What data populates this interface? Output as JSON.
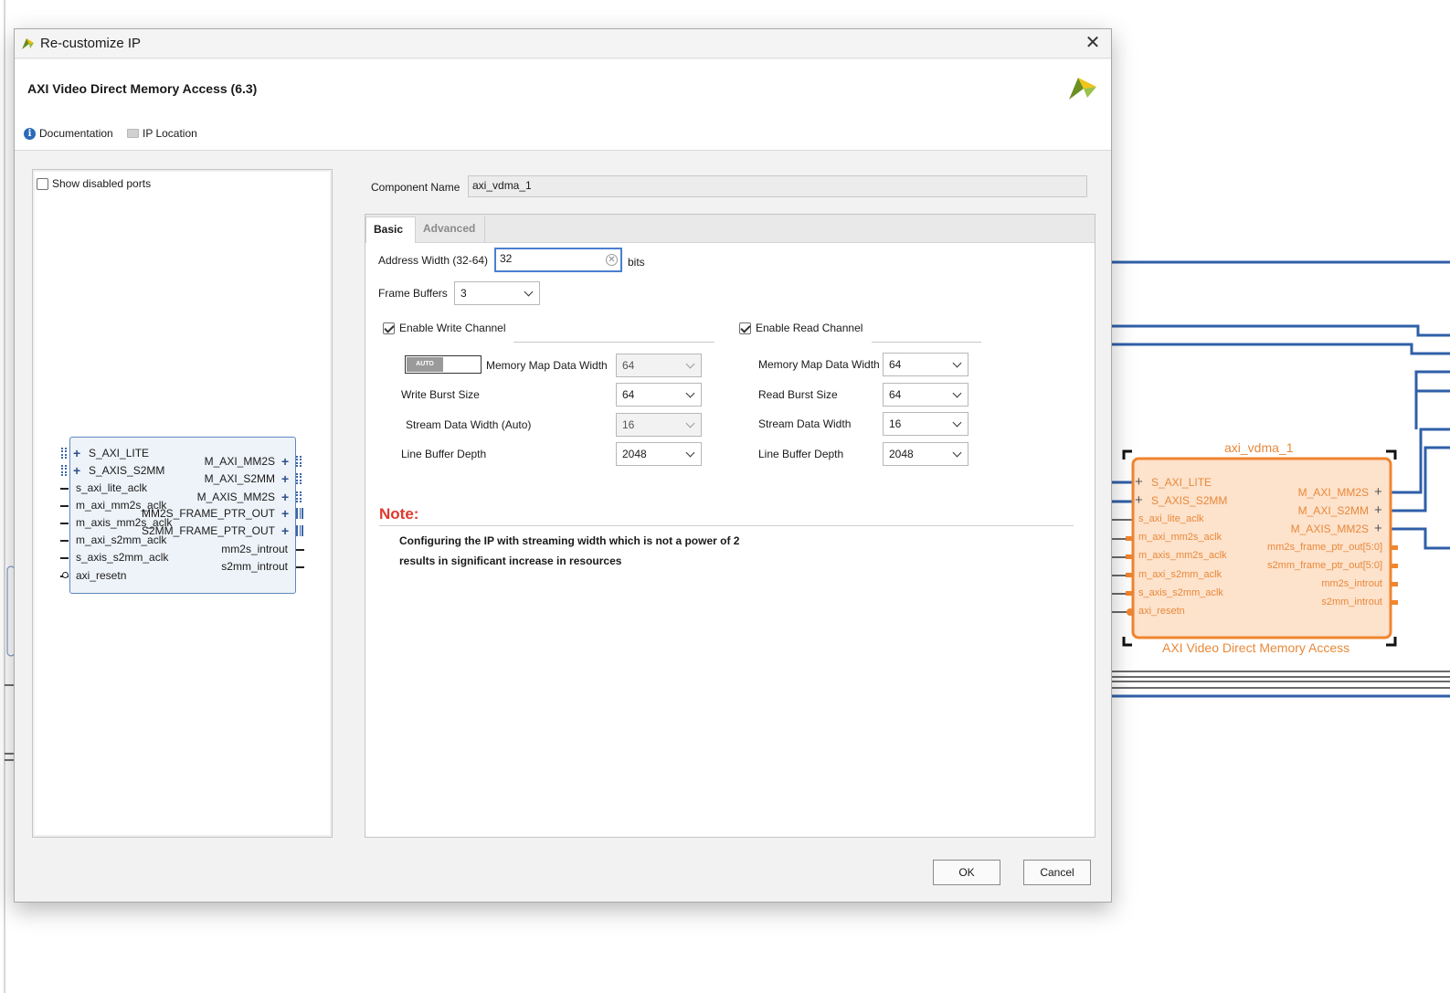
{
  "colors": {
    "accent_blue": "#2f5fa8",
    "orange_block": "#f0852f",
    "orange_fill": "#fde2cc",
    "note_red": "#e03a2e"
  },
  "dialog": {
    "title": "Re-customize IP",
    "ip_title": "AXI Video Direct Memory Access (6.3)",
    "links": {
      "documentation": "Documentation",
      "ip_location": "IP Location"
    },
    "left": {
      "show_disabled_label": "Show disabled ports",
      "block": {
        "left_ports": [
          "S_AXI_LITE",
          "S_AXIS_S2MM",
          "s_axi_lite_aclk",
          "m_axi_mm2s_aclk",
          "m_axis_mm2s_aclk",
          "m_axi_s2mm_aclk",
          "s_axis_s2mm_aclk",
          "axi_resetn"
        ],
        "right_ports": [
          "M_AXI_MM2S",
          "M_AXI_S2MM",
          "M_AXIS_MM2S",
          "MM2S_FRAME_PTR_OUT",
          "S2MM_FRAME_PTR_OUT",
          "mm2s_introut",
          "s2mm_introut"
        ]
      }
    },
    "right": {
      "component_name_label": "Component Name",
      "component_name_value": "axi_vdma_1",
      "tabs": [
        "Basic",
        "Advanced"
      ],
      "address_width_label": "Address Width (32-64)",
      "address_width_value": "32",
      "address_width_unit": "bits",
      "frame_buffers_label": "Frame Buffers",
      "frame_buffers_value": "3",
      "write": {
        "enable_label": "Enable Write Channel",
        "auto_label": "AUTO",
        "mm_data_width_label": "Memory Map Data Width",
        "mm_data_width_value": "64",
        "burst_size_label": "Write Burst Size",
        "burst_size_value": "64",
        "stream_width_label": "Stream Data Width (Auto)",
        "stream_width_value": "16",
        "line_buffer_label": "Line Buffer Depth",
        "line_buffer_value": "2048"
      },
      "read": {
        "enable_label": "Enable Read Channel",
        "mm_data_width_label": "Memory Map Data Width",
        "mm_data_width_value": "64",
        "burst_size_label": "Read Burst Size",
        "burst_size_value": "64",
        "stream_width_label": "Stream Data Width",
        "stream_width_value": "16",
        "line_buffer_label": "Line Buffer Depth",
        "line_buffer_value": "2048"
      },
      "note_title": "Note:",
      "note_line1": "Configuring the IP with streaming width which is not a power of 2",
      "note_line2": "results in significant increase in resources"
    },
    "buttons": {
      "ok": "OK",
      "cancel": "Cancel"
    }
  },
  "background_block": {
    "instance_name": "axi_vdma_1",
    "caption": "AXI Video Direct Memory Access",
    "left_ports": [
      "S_AXI_LITE",
      "S_AXIS_S2MM",
      "s_axi_lite_aclk",
      "m_axi_mm2s_aclk",
      "m_axis_mm2s_aclk",
      "m_axi_s2mm_aclk",
      "s_axis_s2mm_aclk",
      "axi_resetn"
    ],
    "right_ports": [
      "M_AXI_MM2S",
      "M_AXI_S2MM",
      "M_AXIS_MM2S",
      "mm2s_frame_ptr_out[5:0]",
      "s2mm_frame_ptr_out[5:0]",
      "mm2s_introut",
      "s2mm_introut"
    ]
  }
}
